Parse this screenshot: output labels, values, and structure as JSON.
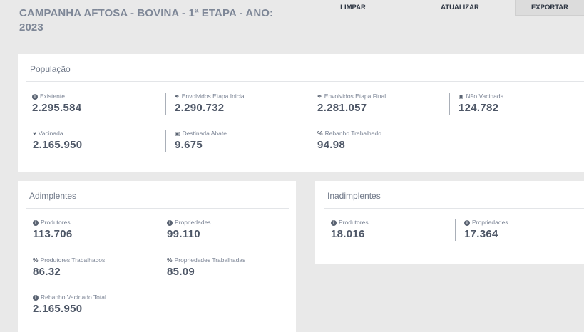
{
  "header": {
    "title": "CAMPANHA AFTOSA - BOVINA - 1ª ETAPA - ANO: 2023",
    "buttons": {
      "limpar": "LIMPAR",
      "atualizar": "ATUALIZAR",
      "exportar": "EXPORTAR"
    }
  },
  "populacao": {
    "title": "População",
    "existente": {
      "label": "Existente",
      "value": "2.295.584",
      "icon": "info-icon"
    },
    "envolvidos_inicial": {
      "label": "Envolvidos Etapa Inicial",
      "value": "2.290.732",
      "icon": "syringe-icon"
    },
    "envolvidos_final": {
      "label": "Envolvidos Etapa Final",
      "value": "2.281.057",
      "icon": "syringe-icon"
    },
    "nao_vacinada": {
      "label": "Não Vacinada",
      "value": "124.782",
      "icon": "truck-icon"
    },
    "vacinada": {
      "label": "Vacinada",
      "value": "2.165.950",
      "icon": "shield-icon"
    },
    "destinada_abate": {
      "label": "Destinada Abate",
      "value": "9.675",
      "icon": "truck-icon"
    },
    "rebanho_trabalhado": {
      "label": "Rebanho Trabalhado",
      "value": "94.98",
      "icon": "percent-icon"
    }
  },
  "adimplentes": {
    "title": "Adimplentes",
    "produtores": {
      "label": "Produtores",
      "value": "113.706"
    },
    "propriedades": {
      "label": "Propriedades",
      "value": "99.110"
    },
    "produtores_trab": {
      "label": "Produtores Trabalhados",
      "value": "86.32"
    },
    "propriedades_trab": {
      "label": "Propriedades Trabalhadas",
      "value": "85.09"
    },
    "rebanho_vacinado": {
      "label": "Rebanho Vacinado Total",
      "value": "2.165.950"
    }
  },
  "inadimplentes": {
    "title": "Inadimplentes",
    "produtores": {
      "label": "Produtores",
      "value": "18.016"
    },
    "propriedades": {
      "label": "Propriedades",
      "value": "17.364"
    }
  }
}
